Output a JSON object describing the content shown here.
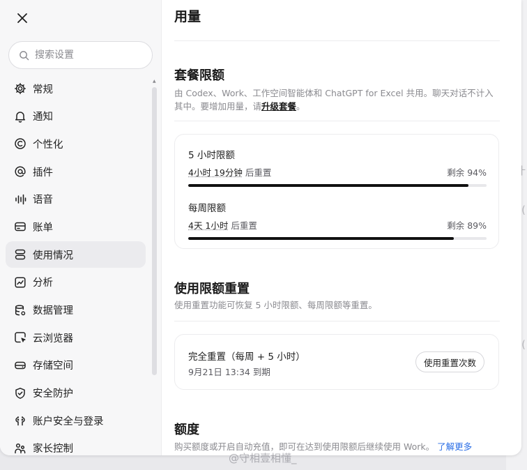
{
  "search": {
    "placeholder": "搜索设置"
  },
  "nav": [
    {
      "label": "常规",
      "icon": "gear-icon"
    },
    {
      "label": "通知",
      "icon": "bell-icon"
    },
    {
      "label": "个性化",
      "icon": "personalize-icon"
    },
    {
      "label": "插件",
      "icon": "at-plugin-icon"
    },
    {
      "label": "语音",
      "icon": "waveform-icon"
    },
    {
      "label": "账单",
      "icon": "card-icon"
    },
    {
      "label": "使用情况",
      "icon": "usage-icon",
      "active": true
    },
    {
      "label": "分析",
      "icon": "chart-icon"
    },
    {
      "label": "数据管理",
      "icon": "database-icon"
    },
    {
      "label": "云浏览器",
      "icon": "cloud-browser-icon"
    },
    {
      "label": "存储空间",
      "icon": "storage-icon"
    },
    {
      "label": "安全防护",
      "icon": "shield-icon"
    },
    {
      "label": "账户安全与登录",
      "icon": "account-security-icon"
    },
    {
      "label": "家长控制",
      "icon": "family-icon"
    }
  ],
  "main": {
    "title": "用量",
    "plan": {
      "title": "套餐限额",
      "desc_prefix": "由 Codex、Work、工作空间智能体和 ChatGPT for Excel 共用。聊天对话不计入其中。要增加用量，请",
      "upgrade_link": "升级套餐",
      "desc_suffix": "。",
      "limits": [
        {
          "name": "5 小时限额",
          "reset_time": "4小时 19分钟",
          "reset_suffix": " 后重置",
          "remaining_label": "剩余 94%",
          "remaining_fraction": 0.94
        },
        {
          "name": "每周限额",
          "reset_time": "4天 1小时",
          "reset_suffix": " 后重置",
          "remaining_label": "剩余 89%",
          "remaining_fraction": 0.89
        }
      ]
    },
    "reset": {
      "title": "使用限额重置",
      "desc": "使用重置功能可恢复 5 小时限额、每周限额等重置。",
      "item_title": "完全重置（每周 + 5 小时）",
      "item_expiry": "9月21日 13:34 到期",
      "button_label": "使用重置次数"
    },
    "credit": {
      "title": "额度",
      "desc": "购买额度或开启自动充值，即可在达到使用限额后继续使用 Work。",
      "learn_more": "了解更多"
    }
  },
  "watermark": "@守相壹相懂_",
  "colors": {
    "accent_link": "#2a6ee6",
    "bar_fill": "#111111",
    "active_nav_bg": "#ebebee"
  }
}
